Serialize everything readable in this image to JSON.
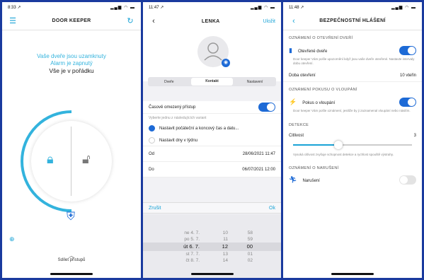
{
  "phone1": {
    "time": "8:33 ↗",
    "signal": "▂▄▆ ◠ ▬",
    "title": "DOOR KEEPER",
    "hero_line1": "Vaše dveře jsou uzamknuty",
    "hero_line2": "Alarm je zapnutý",
    "hero_line3": "Vše je v pořádku",
    "bottom_label": "Sdílet přístupů",
    "colors": {
      "accent": "#33b3dd",
      "brand": "#1d6ad6"
    }
  },
  "phone2": {
    "time": "11:47 ↗",
    "signal": "▂▄▆ ◠ ▬",
    "title": "LENKA",
    "right_action": "Uložit",
    "tabs": [
      "Dveře",
      "Kontakt",
      "Nastavení"
    ],
    "active_tab": 1,
    "time_limited_label": "Časově omezený přístup",
    "hint": "Vyberte jednu z následujících variant",
    "options": [
      "Nastavit počáteční a koncový čas a datu...",
      "Nastavit dny v týdnu"
    ],
    "from_label": "Od",
    "from_value": "28/06/2021 11:47",
    "to_label": "Do",
    "to_value": "06/07/2021 12:00",
    "picker_cancel": "Zrušit",
    "picker_ok": "Ok",
    "picker_rows": [
      [
        "ne 4. 7.",
        "10",
        "58"
      ],
      [
        "po 5. 7.",
        "11",
        "59"
      ],
      [
        "út 6. 7.",
        "12",
        "00"
      ],
      [
        "st 7. 7.",
        "13",
        "01"
      ],
      [
        "čt 8. 7.",
        "14",
        "02"
      ]
    ],
    "picker_selected": 2
  },
  "phone3": {
    "time": "11:48 ↗",
    "signal": "▂▄▆ ◠ ▬",
    "title": "BEZPEČNOSTNÍ HLÁŠENÍ",
    "sec1": "OZNÁMENÍ O OTEVŘENÍ DVEŘÍ",
    "row1": "Otevřené dveře",
    "note1": "Door keeper Vám pošle upozornění když jsou vaše dveře otevřené. Nastavte intervaly dobu otevření.",
    "row2_label": "Doba otevření",
    "row2_value": "10 vteřin",
    "sec2": "OZNÁMENÍ POKUSU O VLOUPÁNÍ",
    "row3": "Pokus o vloupání",
    "note2": "Door keeper Vám pošle oznámení, jestliže by ji zaznamenal vloupání nebo násilím.",
    "sec3": "DETEKCE",
    "row4_label": "Citlivost",
    "row4_value": "3",
    "slider_level": 0.38,
    "note3": "Vysoká citlivost zvyšuje schopnost detekce a rychlost spouště výstrahy.",
    "sec4": "OZNÁMENÍ O NARUŠENÍ",
    "row5": "Narušení"
  }
}
